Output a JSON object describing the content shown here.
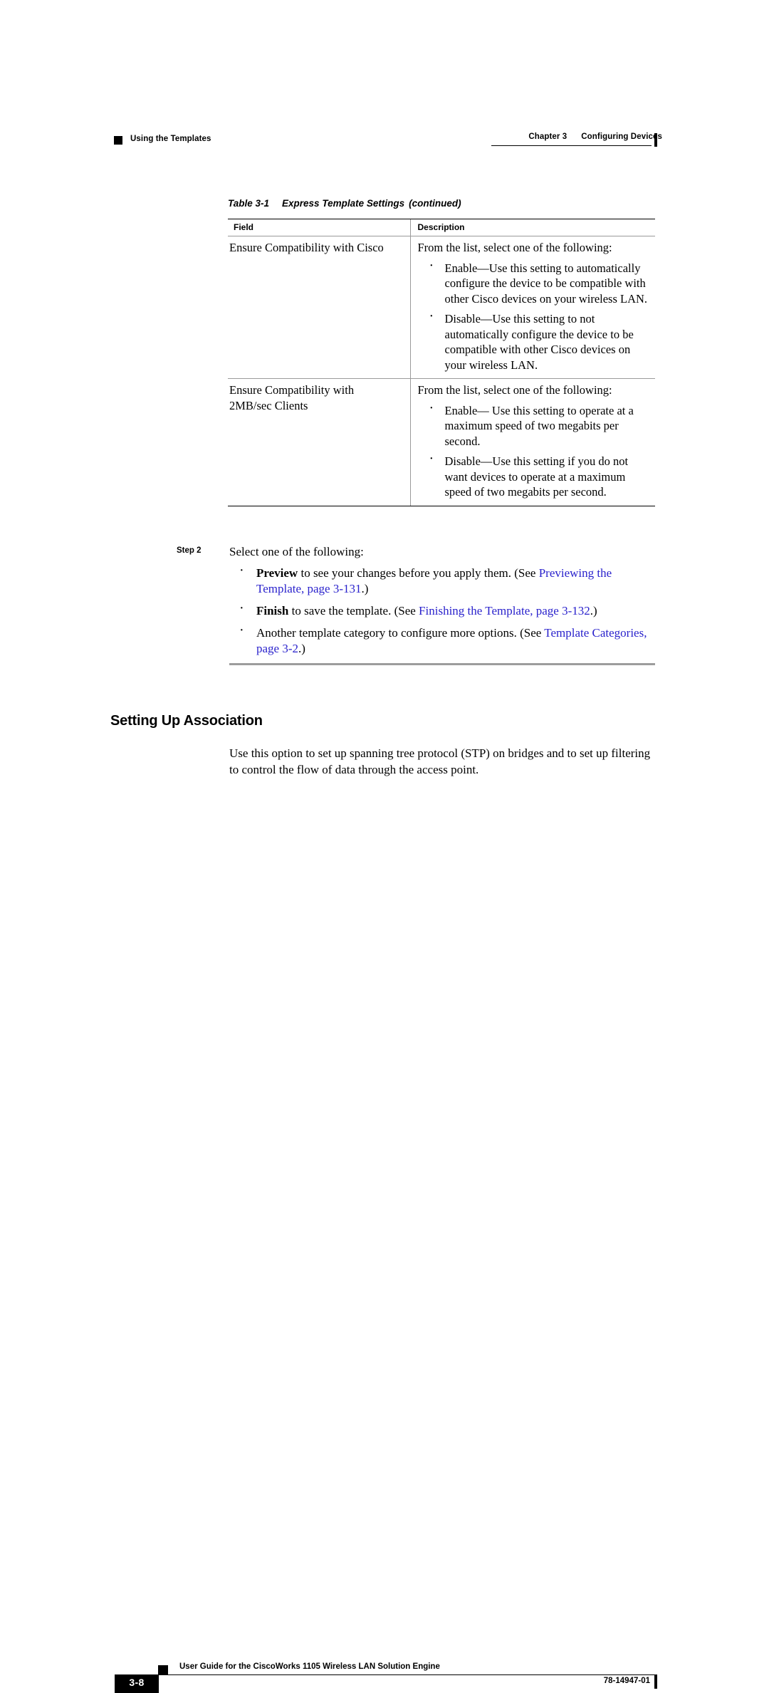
{
  "header": {
    "chapter_number": "Chapter 3",
    "chapter_title": "Configuring Devices",
    "section_marker_label": "Using the Templates"
  },
  "table": {
    "caption_number": "Table 3-1",
    "caption_title": "Express Template Settings",
    "caption_continued": "(continued)",
    "columns": [
      "Field",
      "Description"
    ],
    "rows": [
      {
        "field_lines": [
          "Ensure Compatibility with Cisco"
        ],
        "description_intro": "From the list, select one of the following:",
        "bullets": [
          "Enable—Use this setting to automatically configure the device to be compatible with other Cisco devices on your wireless LAN.",
          "Disable—Use this setting to not automatically configure the device to be compatible with other Cisco devices on your wireless LAN."
        ]
      },
      {
        "field_lines": [
          "Ensure Compatibility with",
          "2MB/sec Clients"
        ],
        "description_intro": "From the list, select one of the following:",
        "bullets": [
          "Enable— Use this setting to operate at a maximum speed of two megabits per second.",
          "Disable—Use this setting if you do not want devices to operate at a maximum speed of two megabits per second."
        ]
      }
    ]
  },
  "step": {
    "label": "Step 2",
    "intro": "Select one of the following:",
    "bullets": [
      {
        "bold_lead": "Preview",
        "text_before_link": " to see your changes before you apply them. (See ",
        "link_text": "Previewing the Template, page 3-131",
        "text_after_link": ".)"
      },
      {
        "bold_lead": "Finish",
        "text_before_link": " to save the template. (See ",
        "link_text": "Finishing the Template, page 3-132",
        "text_after_link": ".)"
      },
      {
        "bold_lead": "",
        "text_before_link": "Another template category to configure more options. (See ",
        "link_text": "Template Categories, page 3-2",
        "text_after_link": ".)"
      }
    ]
  },
  "section": {
    "heading": "Setting Up Association",
    "body": "Use this option to set up spanning tree protocol (STP) on bridges and to set up filtering to control the flow of data through the access point."
  },
  "footer": {
    "guide_title": "User Guide for the CiscoWorks 1105 Wireless LAN Solution Engine",
    "page_number": "3-8",
    "document_number": "78-14947-01"
  },
  "colors": {
    "xref_blue": "#2a22cc",
    "rule_gray": "#9c9c9c",
    "text_black": "#000000"
  }
}
